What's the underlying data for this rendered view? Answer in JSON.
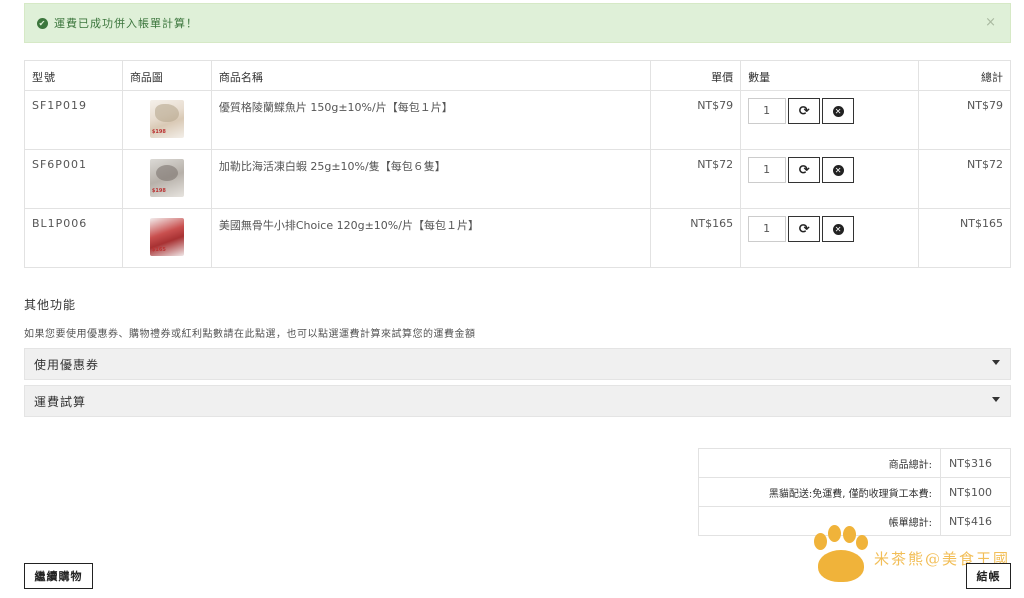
{
  "alert": {
    "message": "運費已成功併入帳單計算！",
    "close": "×"
  },
  "table": {
    "headers": {
      "model": "型號",
      "image": "商品圖",
      "name": "商品名稱",
      "price": "單價",
      "qty": "數量",
      "total": "總計"
    },
    "rows": [
      {
        "model": "SF1P019",
        "name": "優質格陵蘭鰈魚片 150g±10%/片【每包１片】",
        "price": "NT$79",
        "qty": "1",
        "total": "NT$79",
        "img": "fish",
        "img_label": "$198"
      },
      {
        "model": "SF6P001",
        "name": "加勒比海活凍白蝦 25g±10%/隻【每包６隻】",
        "price": "NT$72",
        "qty": "1",
        "total": "NT$72",
        "img": "shrimp",
        "img_label": "$198"
      },
      {
        "model": "BL1P006",
        "name": "美國無骨牛小排Choice 120g±10%/片【每包１片】",
        "price": "NT$165",
        "qty": "1",
        "total": "NT$165",
        "img": "beef",
        "img_label": "$165"
      }
    ]
  },
  "other": {
    "title": "其他功能",
    "desc": "如果您要使用優惠券、購物禮券或紅利點數請在此點選，也可以點選運費計算來試算您的運費金額",
    "coupon": "使用優惠券",
    "shipping_calc": "運費試算"
  },
  "totals": {
    "subtotal_label": "商品總計:",
    "subtotal": "NT$316",
    "shipping_label": "黑貓配送:免運費, 僅酌收理貨工本費:",
    "shipping": "NT$100",
    "total_label": "帳單總計:",
    "total": "NT$416"
  },
  "buttons": {
    "continue": "繼續購物",
    "checkout": "結帳"
  },
  "watermark": {
    "text": "米茶熊@美食王國"
  },
  "colors": {
    "alert_bg": "#dff0d8",
    "alert_text": "#3c763d",
    "watermark": "#f0b33a"
  }
}
